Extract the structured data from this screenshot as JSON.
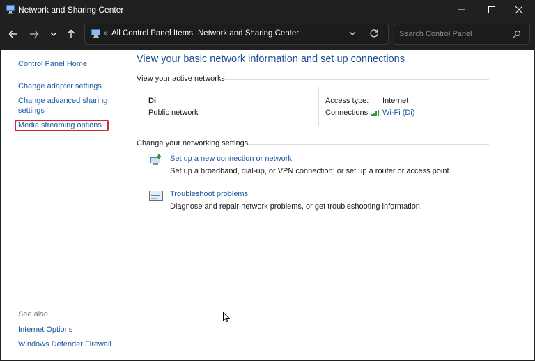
{
  "window": {
    "title": "Network and Sharing Center"
  },
  "address": {
    "crumbs": [
      "All Control Panel Items",
      "Network and Sharing Center"
    ],
    "overflow": "«",
    "separator": "›"
  },
  "search": {
    "placeholder": "Search Control Panel"
  },
  "sidebar": {
    "home": "Control Panel Home",
    "items": [
      "Change adapter settings",
      "Change advanced sharing settings",
      "Media streaming options"
    ],
    "see_also_label": "See also",
    "see_also": [
      "Internet Options",
      "Windows Defender Firewall"
    ]
  },
  "main": {
    "heading": "View your basic network information and set up connections",
    "active_networks_label": "View your active networks",
    "network": {
      "name": "Di",
      "type": "Public network",
      "access_type_label": "Access type:",
      "access_type": "Internet",
      "connections_label": "Connections:",
      "connection": "Wi-Fi (Di)"
    },
    "change_settings_label": "Change your networking settings",
    "tasks": [
      {
        "title": "Set up a new connection or network",
        "desc": "Set up a broadband, dial-up, or VPN connection; or set up a router or access point.",
        "icon": "new-connection-icon"
      },
      {
        "title": "Troubleshoot problems",
        "desc": "Diagnose and repair network problems, or get troubleshooting information.",
        "icon": "troubleshoot-icon"
      }
    ]
  },
  "colors": {
    "link": "#1b56a5",
    "heading": "#1e4f91",
    "highlight": "#d8282f",
    "titlebar": "#202020"
  }
}
